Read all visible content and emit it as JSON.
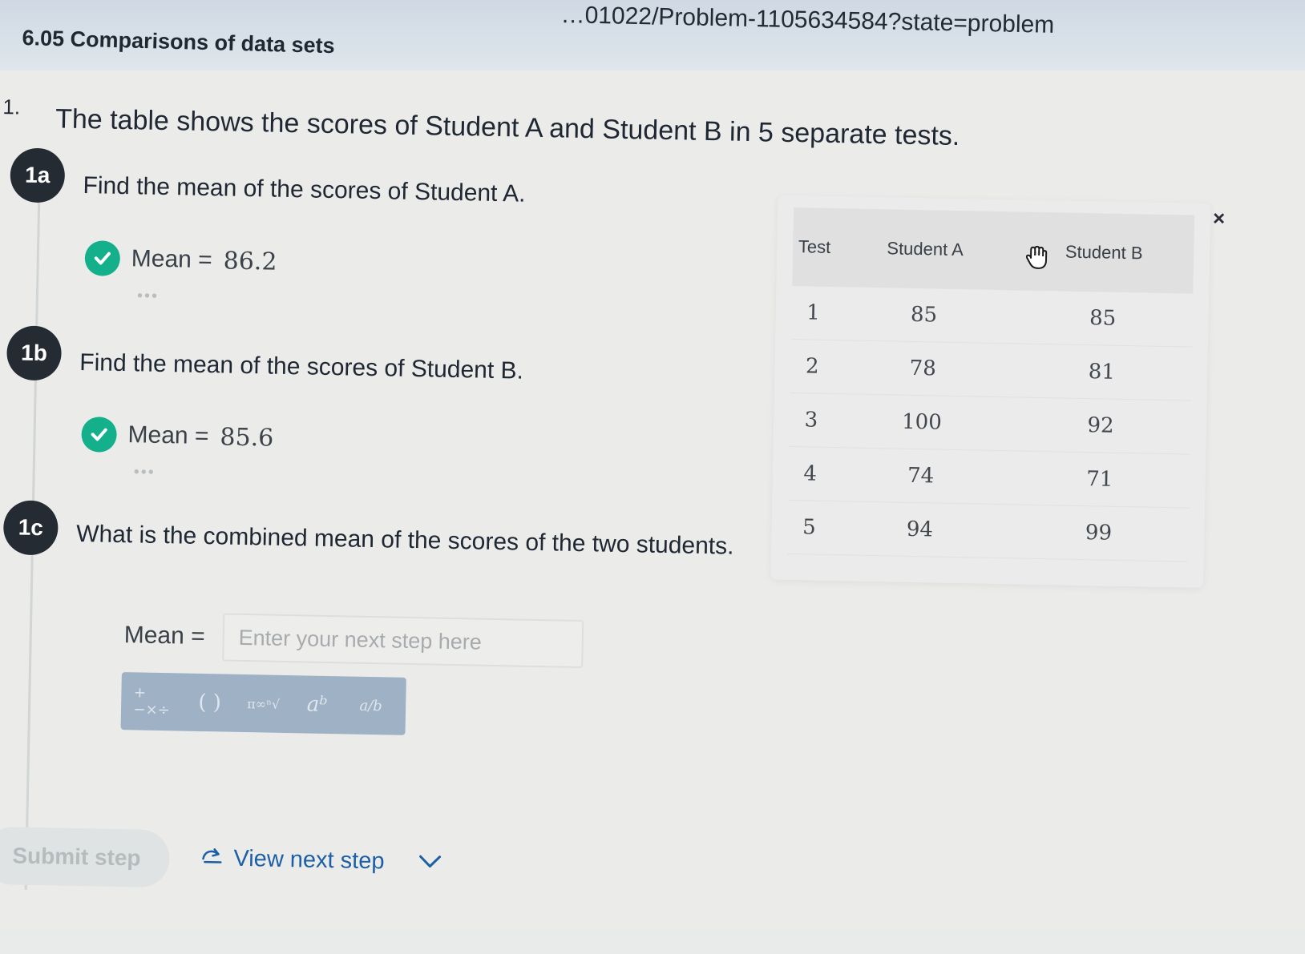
{
  "browser": {
    "url_fragment": "…01022/Problem-1105634584?state=problem"
  },
  "page": {
    "title": "6.05 Comparisons of data sets"
  },
  "question": {
    "number": "1.",
    "text": "The table shows the scores of Student A and Student B in 5 separate tests."
  },
  "parts": [
    {
      "badge": "1a",
      "text": "Find the mean of the scores of Student A.",
      "answer_label": "Mean =",
      "answer_value": "86.2",
      "more": "•••"
    },
    {
      "badge": "1b",
      "text": "Find the mean of the scores of Student B.",
      "answer_label": "Mean =",
      "answer_value": "85.6",
      "more": "•••"
    },
    {
      "badge": "1c",
      "text": "What is the combined mean of the scores of the two students.",
      "answer_label": "Mean =",
      "input_placeholder": "Enter your next step here",
      "input_value": ""
    }
  ],
  "math_toolbar": {
    "tools": [
      "+−×÷",
      "( )",
      "π∞ⁿ√",
      "aᵇ",
      "a/b"
    ]
  },
  "actions": {
    "submit_label": "Submit step",
    "next_step_label": "View next step"
  },
  "score_table": {
    "headers": [
      "Test",
      "Student A",
      "Student B"
    ],
    "rows": [
      [
        "1",
        "85",
        "85"
      ],
      [
        "2",
        "78",
        "81"
      ],
      [
        "3",
        "100",
        "92"
      ],
      [
        "4",
        "74",
        "71"
      ],
      [
        "5",
        "94",
        "99"
      ]
    ],
    "close_label": "×"
  },
  "colors": {
    "check_green": "#14b08c",
    "badge_dark": "#252b33",
    "toolbar_blue": "#9fb1c4",
    "link_blue": "#1d5fa6"
  }
}
